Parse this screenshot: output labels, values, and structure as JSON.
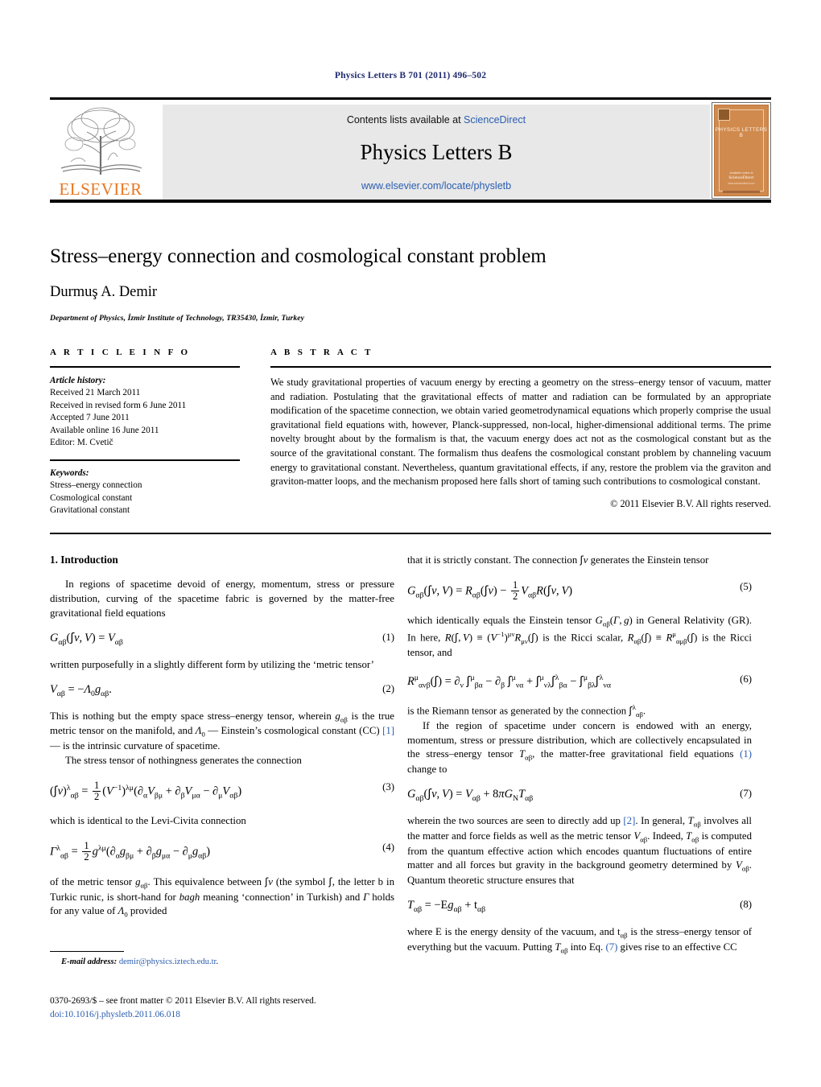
{
  "running_head": "Physics Letters B 701 (2011) 496–502",
  "header": {
    "contents_line_prefix": "Contents lists available at ",
    "contents_line_link": "ScienceDirect",
    "journal_title": "Physics Letters B",
    "journal_url": "www.elsevier.com/locate/physletb",
    "publisher_name": "ELSEVIER",
    "publisher_accent_color": "#e87722",
    "link_color": "#2a5db0",
    "cover": {
      "journal_name": "PHYSICS LETTERS B",
      "foot_line1": "Available online at",
      "foot_line2": "ScienceDirect",
      "foot_line3": "www.sciencedirect.com",
      "background_color": "#d08a4e"
    }
  },
  "title_block": {
    "title": "Stress–energy connection and cosmological constant problem",
    "author": "Durmuş A. Demir",
    "affiliation": "Department of Physics, İzmir Institute of Technology, TR35430, İzmir, Turkey"
  },
  "article_info": {
    "heading": "A R T I C L E   I N F O",
    "history_label": "Article history:",
    "history": [
      "Received 21 March 2011",
      "Received in revised form 6 June 2011",
      "Accepted 7 June 2011",
      "Available online 16 June 2011",
      "Editor: M. Cvetič"
    ],
    "keywords_label": "Keywords:",
    "keywords": [
      "Stress–energy connection",
      "Cosmological constant",
      "Gravitational constant"
    ]
  },
  "abstract": {
    "heading": "A B S T R A C T",
    "text": "We study gravitational properties of vacuum energy by erecting a geometry on the stress–energy tensor of vacuum, matter and radiation. Postulating that the gravitational effects of matter and radiation can be formulated by an appropriate modification of the spacetime connection, we obtain varied geometrodynamical equations which properly comprise the usual gravitational field equations with, however, Planck-suppressed, non-local, higher-dimensional additional terms. The prime novelty brought about by the formalism is that, the vacuum energy does act not as the cosmological constant but as the source of the gravitational constant. The formalism thus deafens the cosmological constant problem by channeling vacuum energy to gravitational constant. Nevertheless, quantum gravitational effects, if any, restore the problem via the graviton and graviton-matter loops, and the mechanism proposed here falls short of taming such contributions to cosmological constant.",
    "copyright": "© 2011 Elsevier B.V. All rights reserved."
  },
  "body": {
    "section1_heading": "1. Introduction",
    "left": {
      "p1": "In regions of spacetime devoid of energy, momentum, stress or pressure distribution, curving of the spacetime fabric is governed by the matter-free gravitational field equations",
      "p2": "written purposefully in a slightly different form by utilizing the ‘metric tensor’",
      "p3_a": "This is nothing but the empty space stress–energy tensor, wherein ",
      "p3_b": " is the true metric tensor on the manifold, and ",
      "p3_c": " — Einstein’s cosmological constant (CC) ",
      "p3_ref": "[1]",
      "p3_d": " — is the intrinsic curvature of spacetime.",
      "p4": "The stress tensor of nothingness generates the connection",
      "p5": "which is identical to the Levi-Civita connection",
      "p6_a": "of the metric tensor ",
      "p6_b": ". This equivalence between ",
      "p6_c": " (the symbol ",
      "p6_d": ", the letter b in Turkic runic, is short-hand for ",
      "p6_italic": "bagh",
      "p6_e": " meaning ‘connection’ in Turkish) and ",
      "p6_f": " holds for any value of ",
      "p6_g": " provided"
    },
    "right": {
      "p1_a": "that it is strictly constant. The connection ",
      "p1_b": " generates the Einstein tensor",
      "p2_a": "which identically equals the Einstein tensor ",
      "p2_b": " in General Relativity (GR). In here, ",
      "p2_c": " is the Ricci scalar, ",
      "p2_d": " is the Ricci tensor, and",
      "p3_a": "is the Riemann tensor as generated by the connection ",
      "p3_b": ".",
      "p4_a": "If the region of spacetime under concern is endowed with an energy, momentum, stress or pressure distribution, which are collectively encapsulated in the stress–energy tensor ",
      "p4_b": ", the matter-free gravitational field equations ",
      "p4_ref": "(1)",
      "p4_c": " change to",
      "p5_a": "wherein the two sources are seen to directly add up ",
      "p5_ref": "[2]",
      "p5_b": ". In general, ",
      "p5_c": " involves all the matter and force fields as well as the metric tensor ",
      "p5_d": ". Indeed, ",
      "p5_e": " is computed from the quantum effective action which encodes quantum fluctuations of entire matter and all forces but gravity in the background geometry determined by ",
      "p5_f": ". Quantum theoretic structure ensures that",
      "p6_a": "where ",
      "p6_b": " is the energy density of the vacuum, and ",
      "p6_c": " is the stress–energy tensor of everything but the vacuum. Putting ",
      "p6_d": " into Eq. ",
      "p6_ref": "(7)",
      "p6_e": " gives rise to an effective CC"
    },
    "equation_numbers": {
      "e1": "(1)",
      "e2": "(2)",
      "e3": "(3)",
      "e4": "(4)",
      "e5": "(5)",
      "e6": "(6)",
      "e7": "(7)",
      "e8": "(8)"
    }
  },
  "footnote": {
    "label": "E-mail address:",
    "email": "demir@physics.iztech.edu.tr",
    "trailing": "."
  },
  "footer": {
    "line1": "0370-2693/$ – see front matter © 2011 Elsevier B.V. All rights reserved.",
    "doi": "doi:10.1016/j.physletb.2011.06.018"
  }
}
